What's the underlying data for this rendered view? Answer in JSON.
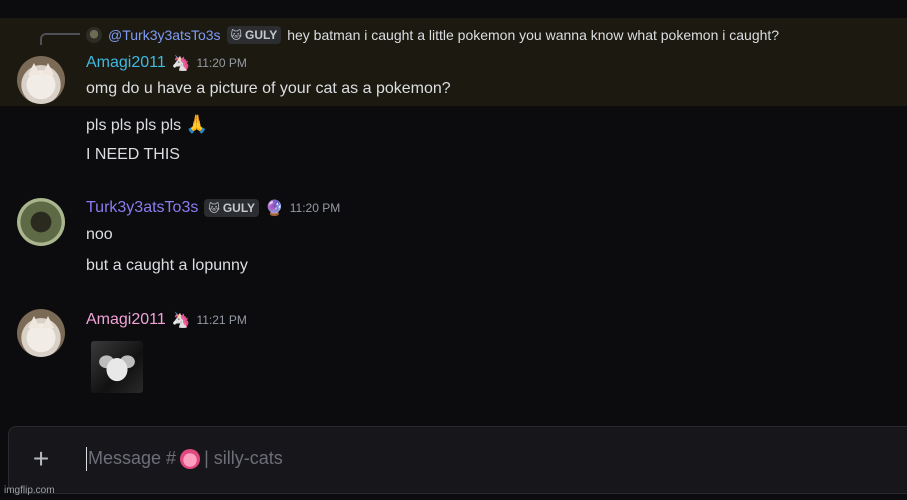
{
  "reply": {
    "author": "@Turk3y3atsTo3s",
    "tag": "GULY",
    "text": "hey batman i caught a little pokemon you wanna know what pokemon i caught?"
  },
  "messages": [
    {
      "username": "Amagi2011",
      "time": "11:20 PM",
      "lines": [
        "omg do u have a picture of your cat as a pokemon?",
        "pls pls pls pls",
        "I NEED THIS"
      ],
      "emoji": "🙏"
    },
    {
      "username": "Turk3y3atsTo3s",
      "tag": "GULY",
      "time": "11:20 PM",
      "lines": [
        "noo",
        "but a caught a lopunny"
      ]
    },
    {
      "username": "Amagi2011",
      "time": "11:21 PM",
      "lines": []
    }
  ],
  "composer": {
    "placeholder_prefix": "Message #",
    "channel": "| silly-cats"
  },
  "watermark": "imgflip.com",
  "colors": {
    "background": "#0c0c0f",
    "highlight": "#1c1910",
    "username_blue": "#3fb9e0",
    "username_purple": "#8a7cf0",
    "username_pink": "#f0a3d6"
  }
}
